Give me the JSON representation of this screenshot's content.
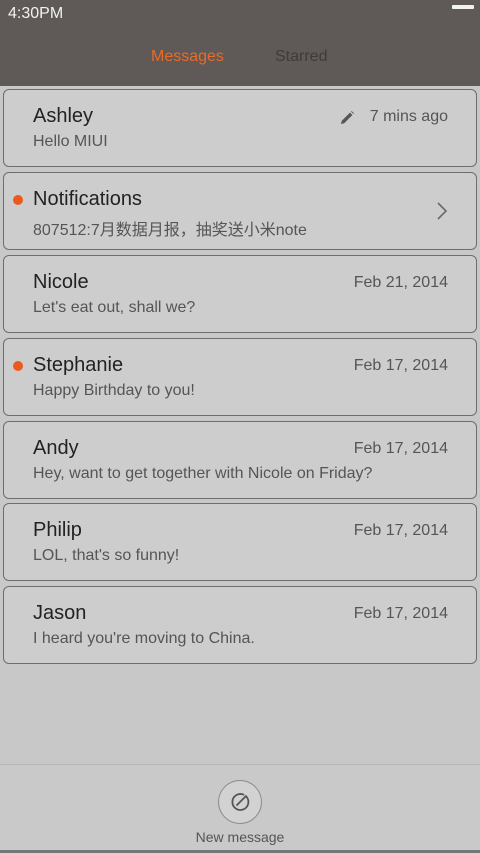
{
  "status_bar": {
    "time": "4:30PM"
  },
  "tabs": [
    {
      "label": "Messages",
      "active": true
    },
    {
      "label": "Starred",
      "active": false
    }
  ],
  "colors": {
    "accent": "#ea6a27",
    "header": "#5f5a58",
    "background": "#c8c8c8"
  },
  "messages": [
    {
      "name": "Ashley",
      "preview": "Hello MIUI",
      "time": "7 mins ago",
      "unread": false,
      "icon": "pencil-icon"
    },
    {
      "name": "Notifications",
      "preview": "807512:7月数据月报，抽奖送小米note",
      "time": "",
      "unread": true,
      "icon": "chevron-right-icon"
    },
    {
      "name": "Nicole",
      "preview": "Let's eat out, shall we?",
      "time": "Feb 21, 2014",
      "unread": false
    },
    {
      "name": "Stephanie",
      "preview": "Happy Birthday to you!",
      "time": "Feb 17, 2014",
      "unread": true
    },
    {
      "name": "Andy",
      "preview": "Hey, want to get together with Nicole on Friday?",
      "time": "Feb 17, 2014",
      "unread": false
    },
    {
      "name": "Philip",
      "preview": "LOL, that's so funny!",
      "time": "Feb 17, 2014",
      "unread": false
    },
    {
      "name": "Jason",
      "preview": "I heard you're moving to China.",
      "time": "Feb 17, 2014",
      "unread": false
    }
  ],
  "bottom_bar": {
    "new_message_label": "New message",
    "icon": "compose-icon"
  }
}
